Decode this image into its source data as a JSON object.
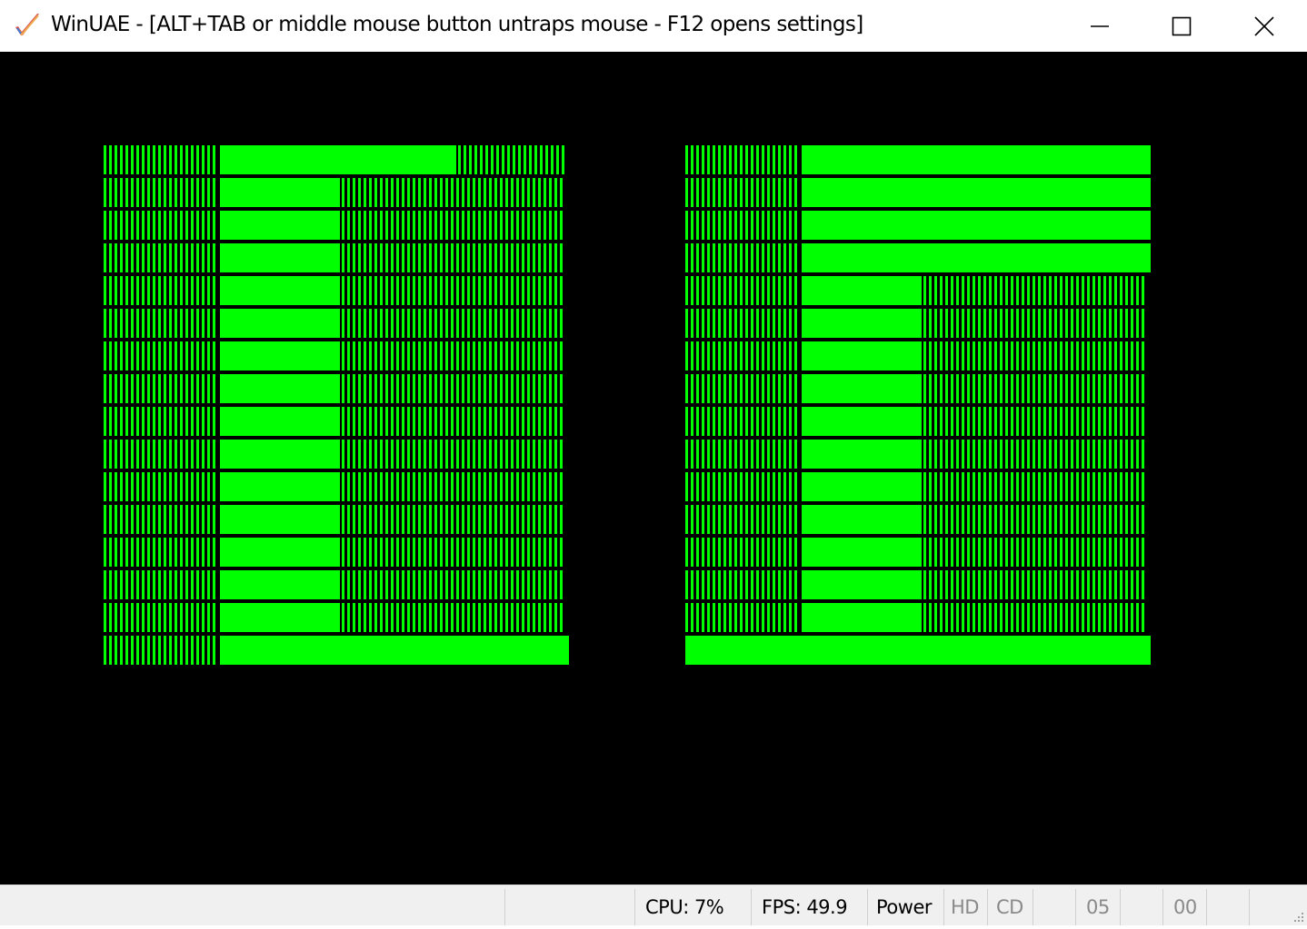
{
  "window": {
    "title": "WinUAE - [ALT+TAB or middle mouse button untraps mouse - F12 opens settings]",
    "app_icon": "checkmark-icon",
    "controls": [
      "minimize-icon",
      "maximize-icon",
      "close-icon"
    ]
  },
  "display": {
    "background": "#000000",
    "pattern_color": "#00ff00"
  },
  "statusbar": {
    "cpu": "CPU: 7%",
    "fps": "FPS: 49.9",
    "power": "Power",
    "hd": "HD",
    "cd": "CD",
    "df0": "05",
    "df1": "00"
  }
}
